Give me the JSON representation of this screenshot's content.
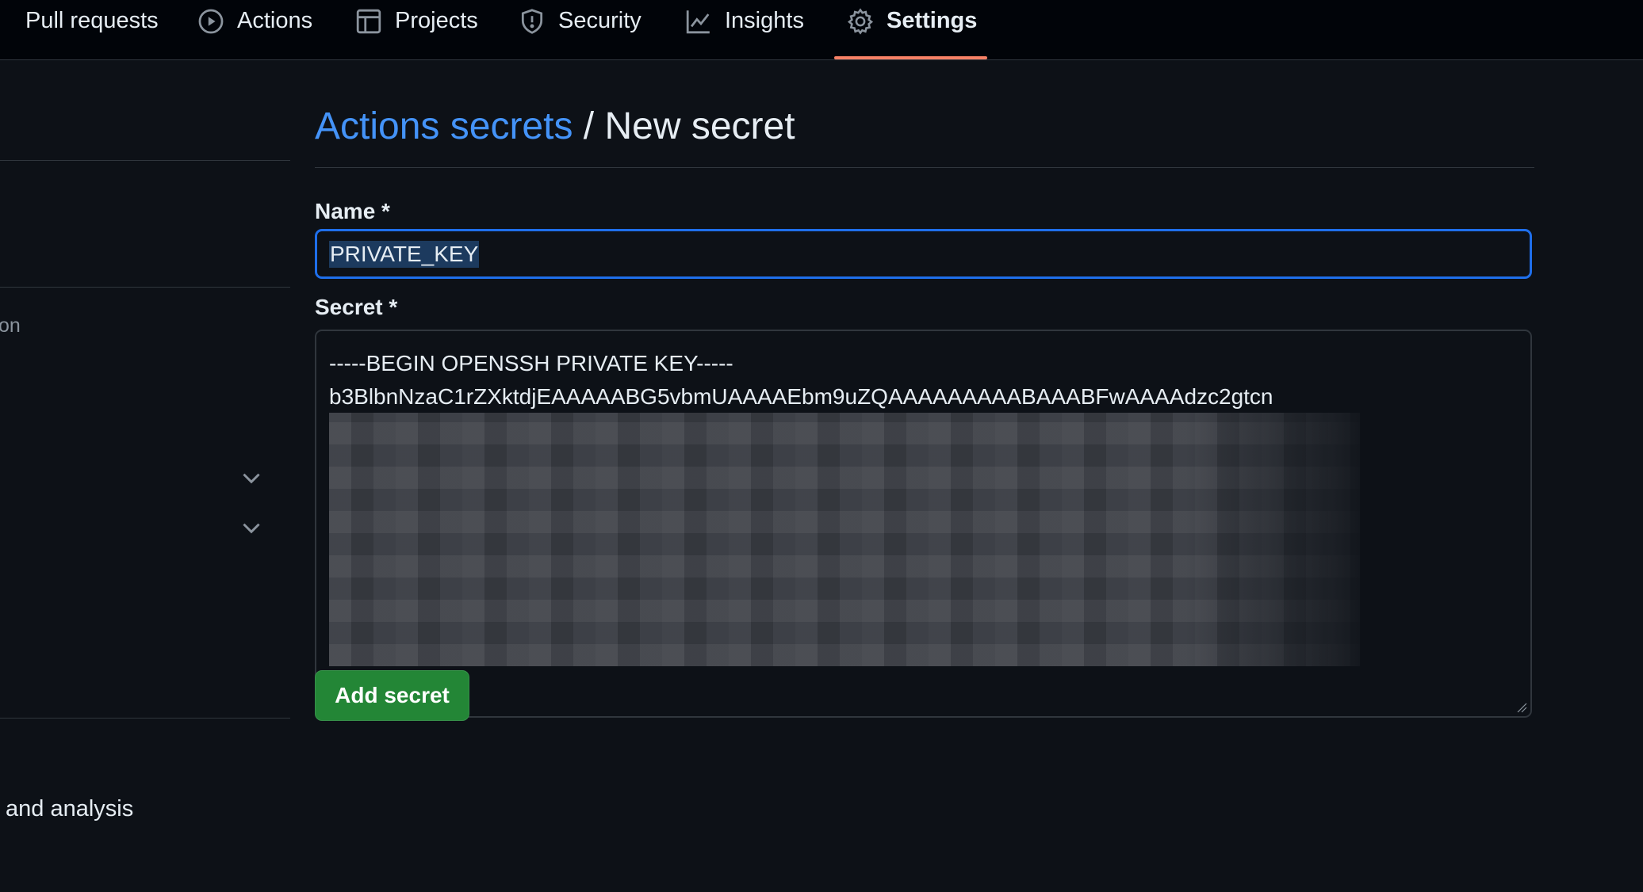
{
  "nav": {
    "items": [
      {
        "label": "Pull requests",
        "icon": "pull-request-icon"
      },
      {
        "label": "Actions",
        "icon": "play-circle-icon"
      },
      {
        "label": "Projects",
        "icon": "table-icon"
      },
      {
        "label": "Security",
        "icon": "shield-icon"
      },
      {
        "label": "Insights",
        "icon": "graph-icon"
      },
      {
        "label": "Settings",
        "icon": "gear-icon",
        "active": true
      }
    ],
    "active_underline_color": "#f78166"
  },
  "sidebar": {
    "partial_label_1": "on",
    "partial_label_2": "and analysis"
  },
  "main": {
    "breadcrumb_link": "Actions secrets",
    "breadcrumb_separator": "/",
    "breadcrumb_current": "New secret",
    "name_label": "Name *",
    "name_value": "PRIVATE_KEY",
    "secret_label": "Secret *",
    "secret_lines": [
      "-----BEGIN OPENSSH PRIVATE KEY-----",
      "b3BlbnNzaC1rZXktdjEAAAAABG5vbmUAAAAEbm9uZQAAAAAAAAABAAABFwAAAAdzc2gtcn"
    ],
    "add_button_label": "Add secret"
  },
  "colors": {
    "link": "#4493f8",
    "focus_border": "#1f6feb",
    "primary_button": "#238636",
    "background": "#0d1117"
  }
}
